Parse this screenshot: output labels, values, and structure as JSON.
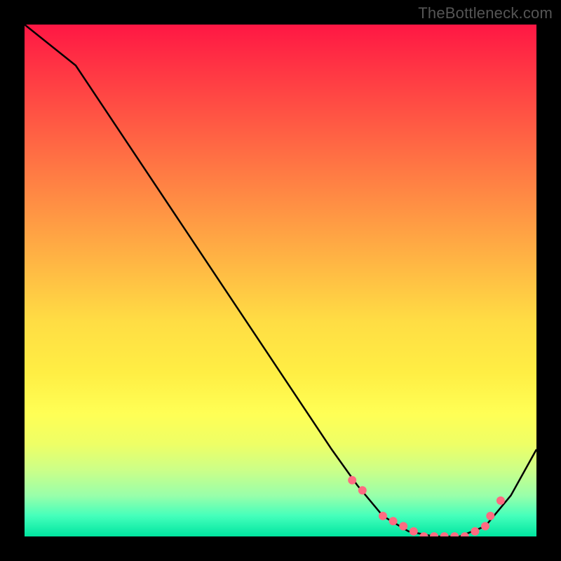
{
  "watermark": "TheBottleneck.com",
  "chart_data": {
    "type": "line",
    "title": "",
    "xlabel": "",
    "ylabel": "",
    "xlim": [
      0,
      100
    ],
    "ylim": [
      0,
      100
    ],
    "series": [
      {
        "name": "bottleneck-curve",
        "x": [
          0,
          10,
          20,
          30,
          40,
          50,
          60,
          65,
          70,
          75,
          80,
          85,
          90,
          95,
          100
        ],
        "values": [
          100,
          92,
          77,
          62,
          47,
          32,
          17,
          10,
          4,
          1,
          0,
          0,
          2,
          8,
          17
        ]
      }
    ],
    "markers": {
      "name": "highlight-points",
      "x": [
        64,
        66,
        70,
        72,
        74,
        76,
        78,
        80,
        82,
        84,
        86,
        88,
        90,
        91,
        93
      ],
      "values": [
        11,
        9,
        4,
        3,
        2,
        1,
        0,
        0,
        0,
        0,
        0,
        1,
        2,
        4,
        7
      ]
    },
    "colors": {
      "curve": "#000000",
      "marker": "#ff6b81",
      "gradient_top": "#ff1744",
      "gradient_bottom": "#00e5a0"
    }
  }
}
